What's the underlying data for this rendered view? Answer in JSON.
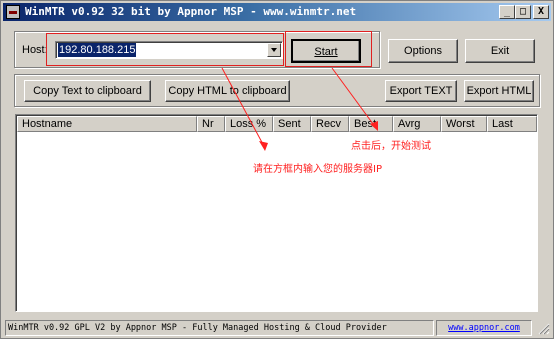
{
  "window": {
    "title": "WinMTR v0.92 32 bit by Appnor MSP - www.winmtr.net",
    "minimize": "_",
    "maximize": "□",
    "close": "X"
  },
  "host": {
    "label": "Host:",
    "value": "192.80.188.215"
  },
  "buttons": {
    "start": "Start",
    "options": "Options",
    "exit": "Exit",
    "copy_text": "Copy Text to clipboard",
    "copy_html": "Copy HTML to clipboard",
    "export_text": "Export TEXT",
    "export_html": "Export HTML"
  },
  "columns": [
    "Hostname",
    "Nr",
    "Loss %",
    "Sent",
    "Recv",
    "Best",
    "Avrg",
    "Worst",
    "Last"
  ],
  "status": {
    "text": "WinMTR v0.92 GPL V2 by Appnor MSP - Fully Managed Hosting & Cloud Provider",
    "link": "www.appnor.com"
  },
  "annotations": {
    "start_note": "点击后，开始测试",
    "host_note": "请在方框内输入您的服务器IP",
    "color": "#ff2020"
  }
}
